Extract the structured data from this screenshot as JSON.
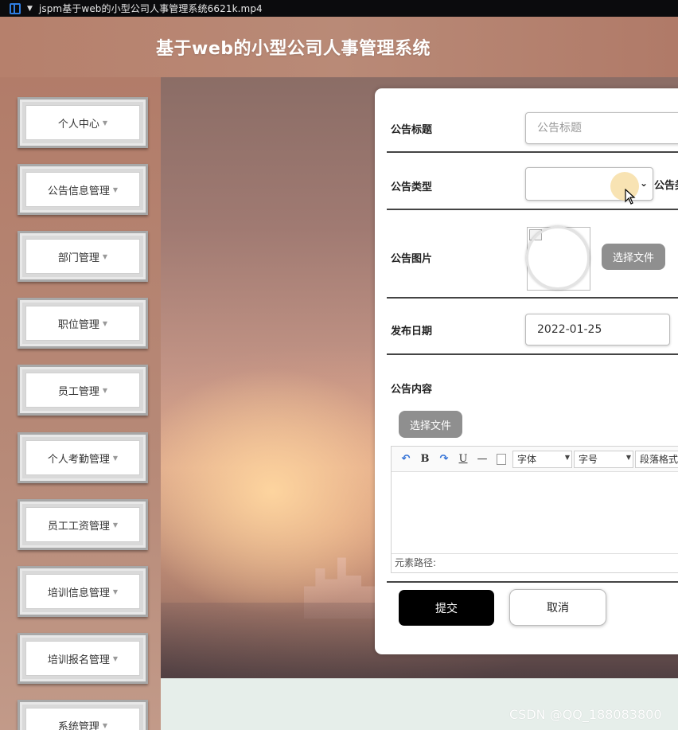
{
  "window": {
    "title": "jspm基于web的小型公司人事管理系统6621k.mp4"
  },
  "header": {
    "title": "基于web的小型公司人事管理系统"
  },
  "sidebar": {
    "items": [
      {
        "label": "个人中心"
      },
      {
        "label": "公告信息管理"
      },
      {
        "label": "部门管理"
      },
      {
        "label": "职位管理"
      },
      {
        "label": "员工管理"
      },
      {
        "label": "个人考勤管理"
      },
      {
        "label": "员工工资管理"
      },
      {
        "label": "培训信息管理"
      },
      {
        "label": "培训报名管理"
      },
      {
        "label": "系统管理"
      }
    ],
    "arrow_glyph": "▼"
  },
  "form": {
    "title_label": "公告标题",
    "title_placeholder": "公告标题",
    "title_value": "",
    "type_label": "公告类型",
    "type_selected": "",
    "type_trailing_label": "公告类",
    "image_label": "公告图片",
    "image_choose_button": "选择文件",
    "date_label": "发布日期",
    "date_value": "2022-01-25",
    "content_label": "公告内容",
    "content_choose_button": "选择文件",
    "editor": {
      "toolbar": {
        "undo": "↶",
        "bold": "B",
        "redo": "↷",
        "underline": "U",
        "hr": "—",
        "font_family": "字体",
        "font_size": "字号",
        "paragraph": "段落格式"
      },
      "status": "元素路径:"
    },
    "submit_button": "提交",
    "cancel_button": "取消"
  },
  "watermark": "CSDN @QQ_188083800",
  "icons": [
    "app-icon",
    "dropdown-caret-icon",
    "chevron-down-icon",
    "mouse-cursor-icon",
    "broken-image-icon",
    "undo-icon",
    "redo-icon",
    "bold-icon",
    "underline-icon",
    "horizontal-rule-icon",
    "document-icon"
  ]
}
